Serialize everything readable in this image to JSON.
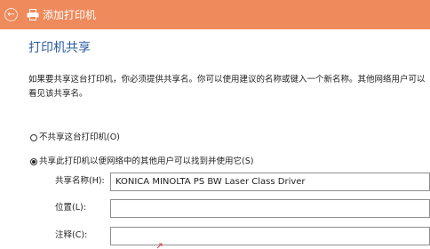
{
  "window": {
    "title": "添加打印机",
    "back_glyph": "←",
    "back_icon": "back-arrow-icon",
    "title_icon": "printer-icon"
  },
  "colors": {
    "titlebar": "#ef8a5c",
    "heading": "#2c5b9e",
    "text": "#222222"
  },
  "page": {
    "heading": "打印机共享",
    "description": "如果要共享这台打印机，你必须提供共享名。你可以使用建议的名称或键入一个新名称。其他网络用户可以看见该共享名。"
  },
  "options": {
    "no_share": {
      "label": "不共享这台打印机(O)",
      "selected": false
    },
    "share": {
      "label": "共享此打印机以便网络中的其他用户可以找到并使用它(S)",
      "selected": true
    }
  },
  "fields": {
    "share_name": {
      "label": "共享名称(H):",
      "value": "KONICA MINOLTA PS BW Laser Class Driver"
    },
    "location": {
      "label": "位置(L):",
      "value": ""
    },
    "comment": {
      "label": "注释(C):",
      "value": ""
    }
  }
}
